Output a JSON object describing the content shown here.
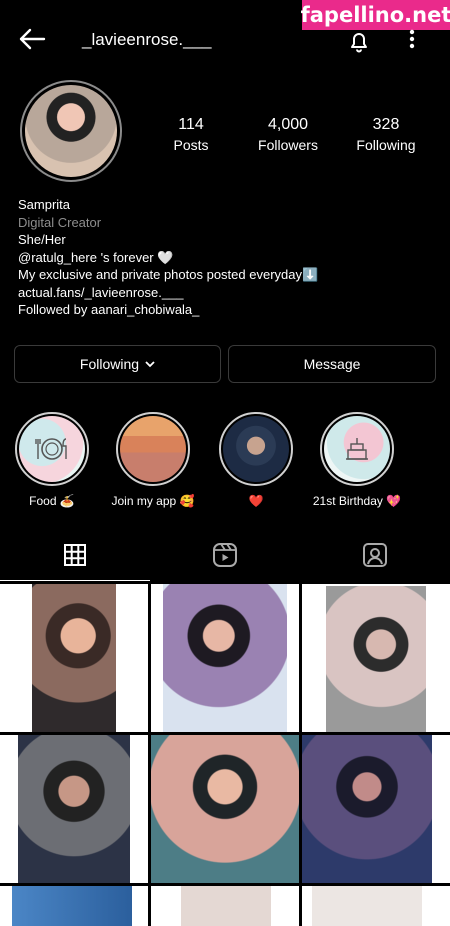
{
  "watermark": "fapellino.net",
  "header": {
    "username": "_lavieenrose.___"
  },
  "stats": [
    {
      "value": "114",
      "label": "Posts"
    },
    {
      "value": "4,000",
      "label": "Followers"
    },
    {
      "value": "328",
      "label": "Following"
    }
  ],
  "bio": {
    "name": "Samprita",
    "category": "Digital Creator",
    "pronouns": "She/Her",
    "line1": "@ratulg_here 's forever 🤍",
    "line2": "My exclusive and private photos posted everyday⬇️",
    "link": "actual.fans/_lavieenrose.___",
    "followed_by_prefix": "Followed by ",
    "followed_by_user": "aanari_chobiwala_"
  },
  "actions": {
    "following": "Following",
    "message": "Message"
  },
  "highlights": [
    {
      "label": "Food 🍝"
    },
    {
      "label": "Join my app 🥰"
    },
    {
      "label": "❤️"
    },
    {
      "label": "21st Birthday 💖"
    }
  ],
  "tabs": [
    "grid",
    "reels",
    "tagged"
  ],
  "colors": {
    "background": "#000000",
    "button_border": "#3a3a3a",
    "watermark_bg": "#ea2a8b",
    "muted": "#8e8e8e"
  }
}
